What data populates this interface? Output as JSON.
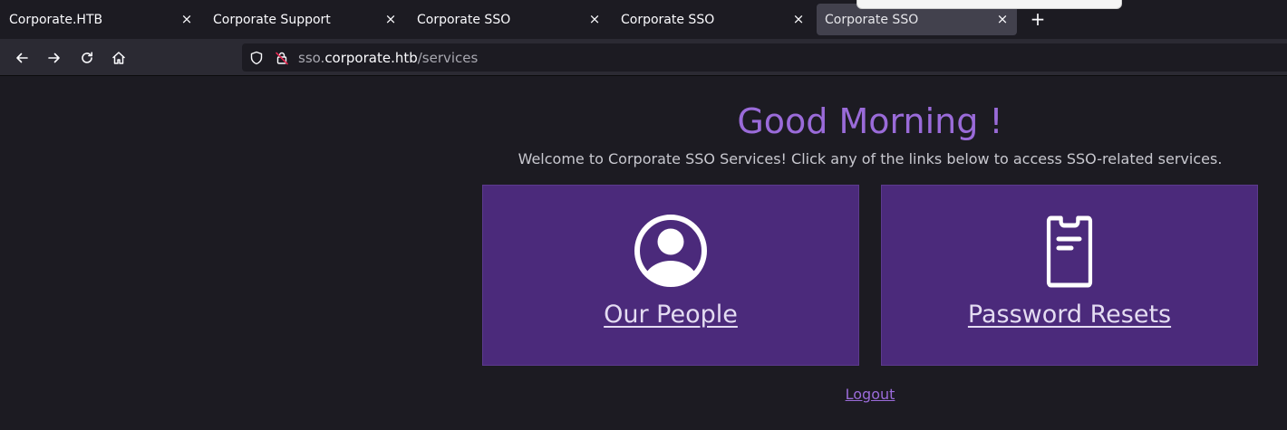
{
  "browser": {
    "tabs": [
      {
        "title": "Corporate.HTB",
        "close": "×",
        "active": false
      },
      {
        "title": "Corporate Support",
        "close": "×",
        "active": false
      },
      {
        "title": "Corporate SSO",
        "close": "×",
        "active": false
      },
      {
        "title": "Corporate SSO",
        "close": "×",
        "active": false
      },
      {
        "title": "Corporate SSO",
        "close": "×",
        "active": true
      }
    ],
    "new_tab": "+",
    "url": {
      "subdomain": "sso.",
      "host": "corporate.htb",
      "path": "/services"
    }
  },
  "page": {
    "greeting": "Good Morning !",
    "welcome": "Welcome to Corporate SSO Services! Click any of the links below to access SSO-related services.",
    "cards": [
      {
        "label": "Our People",
        "icon": "user-circle-icon"
      },
      {
        "label": "Password Resets",
        "icon": "phone-document-icon"
      }
    ],
    "logout": "Logout"
  },
  "colors": {
    "accent": "#9a6bd9",
    "card_background": "#4b2a7b",
    "page_background": "#1c1b22",
    "toolbar_background": "#2b2a33"
  }
}
